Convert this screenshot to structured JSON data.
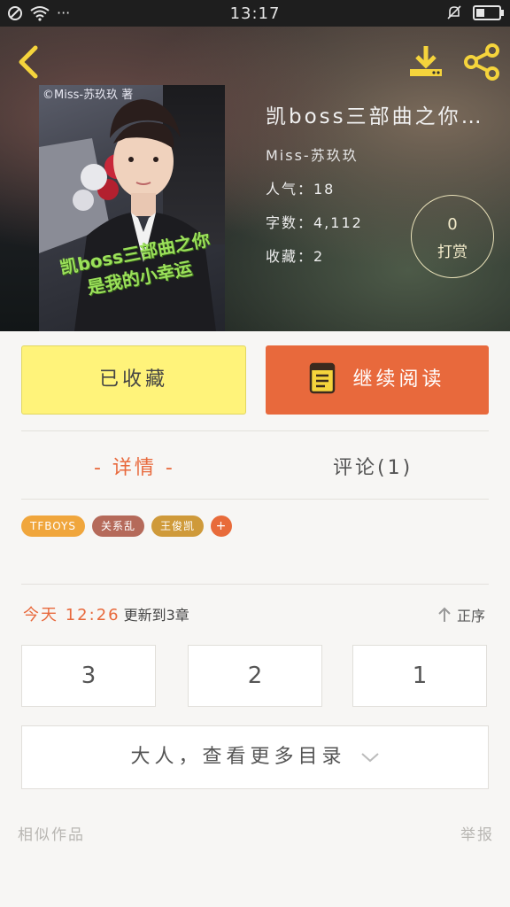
{
  "status_bar": {
    "time": "13:17",
    "dots": "···"
  },
  "book": {
    "title": "凯boss三部曲之你…",
    "author": "Miss-苏玖玖",
    "popularity": "人气：18",
    "word_count": "字数：4,112",
    "favorites": "收藏：2",
    "cover_caption": "©Miss-苏玖玖 著",
    "cover_watermark": "凯boss三部曲之你是我的小幸运"
  },
  "tip": {
    "count": "0",
    "label": "打赏"
  },
  "actions": {
    "favorited": "已收藏",
    "continue_reading": "继续阅读"
  },
  "tabs": {
    "detail": "- 详情 -",
    "comments": "评论(1)"
  },
  "tags": [
    {
      "label": "TFBOYS",
      "color": "#f0a63c"
    },
    {
      "label": "关系乱",
      "color": "#b56a5a"
    },
    {
      "label": "王俊凯",
      "color": "#cf9a3a"
    }
  ],
  "tag_add": "+",
  "update": {
    "when": "今天 12:26",
    "what": "更新到3章",
    "sort": "正序"
  },
  "chapters": [
    "3",
    "2",
    "1"
  ],
  "more_catalog": "大人，查看更多目录",
  "footer": {
    "similar": "相似作品",
    "report": "举报"
  }
}
